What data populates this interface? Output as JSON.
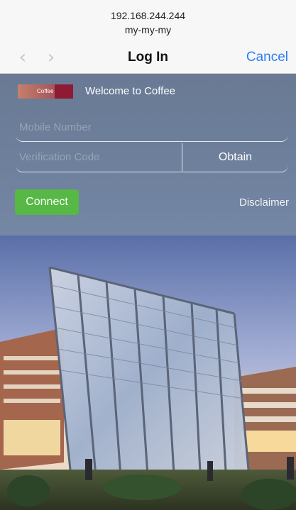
{
  "browser": {
    "address": "192.168.244.244",
    "address_sub": "my-my-my",
    "back_icon": "chevron-left-icon",
    "forward_icon": "chevron-right-icon",
    "title": "Log In",
    "cancel_label": "Cancel"
  },
  "portal": {
    "logo_text": "Coffee",
    "welcome": "Welcome to Coffee",
    "mobile_placeholder": "Mobile Number",
    "code_placeholder": "Verification Code",
    "obtain_label": "Obtain",
    "connect_label": "Connect",
    "disclaimer_label": "Disclaimer",
    "accent_color": "#57b845",
    "panel_color": "#6d7f9b",
    "link_color": "#2f7cf6"
  }
}
